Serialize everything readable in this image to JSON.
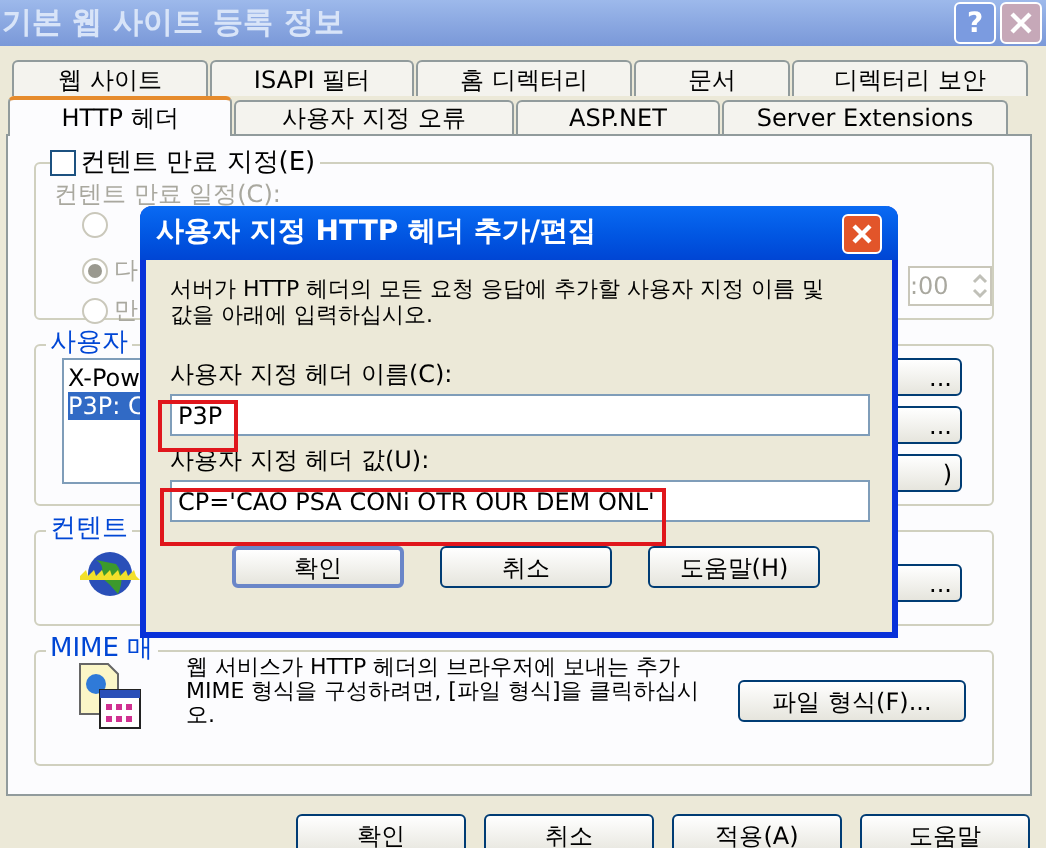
{
  "window": {
    "title": "기본 웹 사이트 등록 정보",
    "help_button": "?"
  },
  "tab_rows": [
    [
      {
        "label": "웹 사이트",
        "selected": false
      },
      {
        "label": "ISAPI 필터",
        "selected": false
      },
      {
        "label": "홈 디렉터리",
        "selected": false
      },
      {
        "label": "문서",
        "selected": false
      },
      {
        "label": "디렉터리 보안",
        "selected": false
      }
    ],
    [
      {
        "label": "HTTP 헤더",
        "selected": true
      },
      {
        "label": "사용자 지정 오류",
        "selected": false
      },
      {
        "label": "ASP.NET",
        "selected": false
      },
      {
        "label": "Server Extensions",
        "selected": false
      }
    ]
  ],
  "expiration": {
    "checkbox": {
      "label": "컨텐트 만료 지정(E)",
      "checked": false
    },
    "disabled": true,
    "group_label": "컨텐트 만료 일정(C):",
    "options": [
      {
        "selected": false
      },
      {
        "label": "다",
        "selected": true
      },
      {
        "label": "만",
        "selected": false
      }
    ],
    "time_field": ":00"
  },
  "custom_headers": {
    "group_label": "사용자",
    "items": [
      {
        "label": "X-Pow",
        "selected": false
      },
      {
        "label": "P3P: C",
        "selected": true
      }
    ],
    "buttons": [
      "...",
      "...",
      ")"
    ]
  },
  "content_rating": {
    "group_label": "컨텐트",
    "button": "..."
  },
  "mime": {
    "group_label": "MIME 매",
    "text": "웹 서비스가 HTTP 헤더의 브라우저에 보내는 추가 MIME 형식을 구성하려면, [파일 형식]을 클릭하십시오.",
    "button": "파일 형식(F)..."
  },
  "buttons": [
    {
      "label": "확인",
      "disabled": false
    },
    {
      "label": "취소",
      "disabled": false
    },
    {
      "label": "적용(A)",
      "disabled": false
    },
    {
      "label": "도움말",
      "disabled": false
    }
  ],
  "dialog": {
    "title": "사용자 지정 HTTP 헤더 추가/편집",
    "description": "서버가 HTTP 헤더의 모든 요청 응답에 추가할 사용자 지정 이름 및 값을 아래에 입력하십시오.",
    "name_label": "사용자 지정 헤더 이름(C):",
    "name_value": "P3P",
    "value_label": "사용자 지정 헤더 값(U):",
    "value_value": "CP='CAO PSA CONi OTR OUR DEM ONL'",
    "buttons": [
      {
        "label": "확인",
        "default": true
      },
      {
        "label": "취소",
        "default": false
      },
      {
        "label": "도움말(H)",
        "default": false
      }
    ]
  }
}
